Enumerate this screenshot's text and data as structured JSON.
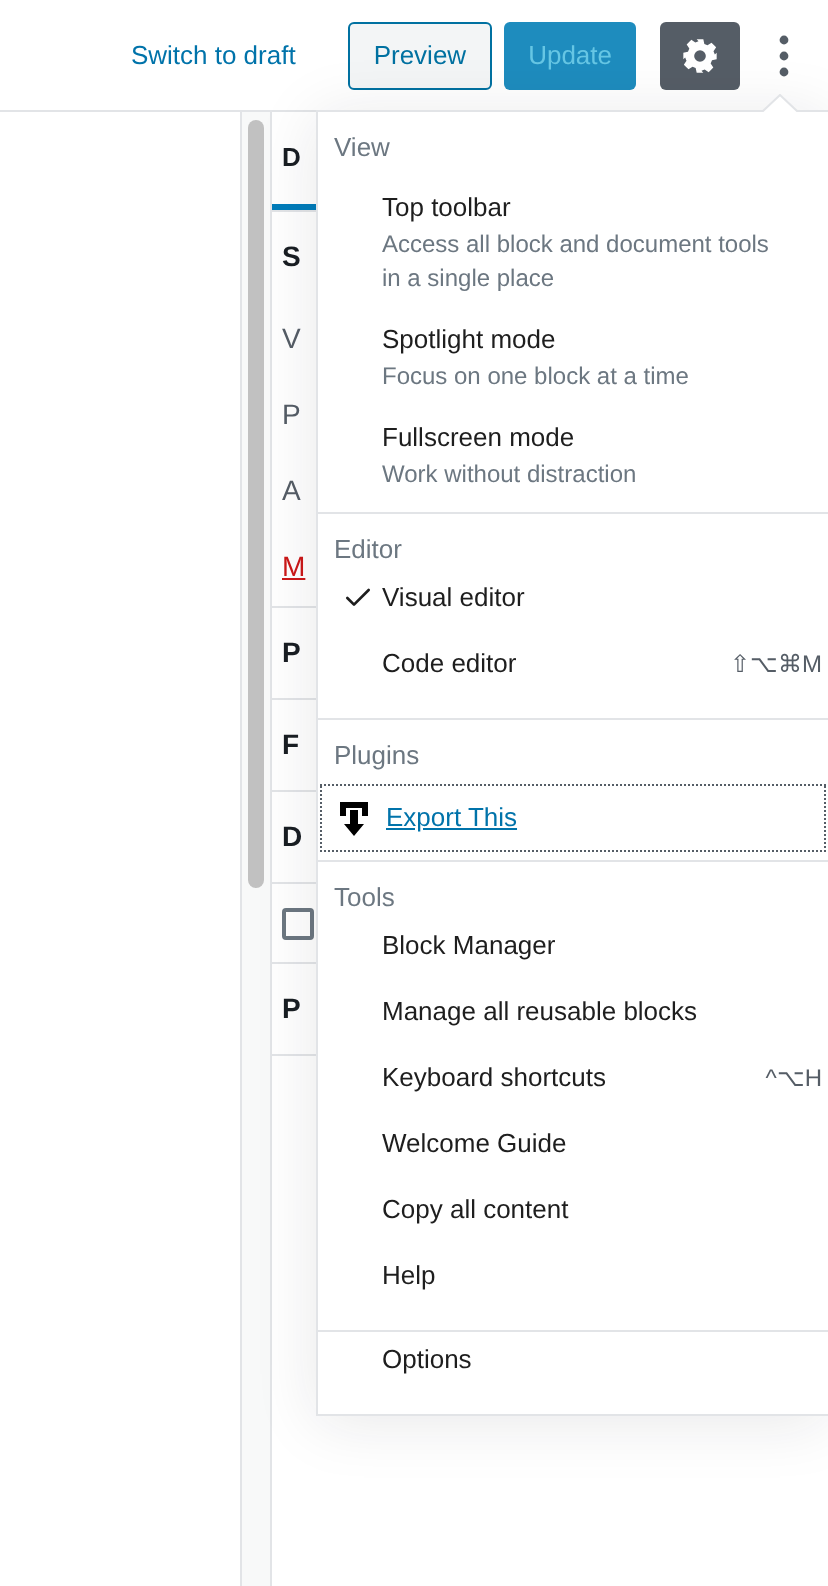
{
  "header": {
    "switch_to_draft": "Switch to draft",
    "preview": "Preview",
    "update": {
      "label": "Update",
      "disabled": true
    },
    "settings": {
      "selected": true
    },
    "more": {
      "expanded": true
    }
  },
  "sidebar": {
    "tabs": [
      {
        "label": "D",
        "selected": true
      }
    ],
    "rows": [
      {
        "kind": "heading",
        "text": "S"
      },
      {
        "kind": "text",
        "text": "V"
      },
      {
        "kind": "text",
        "text": "P"
      },
      {
        "kind": "text",
        "text": "A"
      },
      {
        "kind": "danger",
        "text": "M"
      },
      {
        "kind": "panel",
        "text": "P"
      },
      {
        "kind": "panel",
        "text": "F"
      },
      {
        "kind": "panel",
        "text": "D"
      },
      {
        "kind": "checkbox",
        "checked": false
      },
      {
        "kind": "panel",
        "text": "P"
      }
    ]
  },
  "menu": {
    "groups": [
      {
        "title": "View",
        "items": [
          {
            "label": "Top toolbar",
            "description": "Access all block and document tools in a single place"
          },
          {
            "label": "Spotlight mode",
            "description": "Focus on one block at a time"
          },
          {
            "label": "Fullscreen mode",
            "description": "Work without distraction"
          }
        ]
      },
      {
        "title": "Editor",
        "items": [
          {
            "label": "Visual editor",
            "checked": true
          },
          {
            "label": "Code editor",
            "shortcut": "⇧⌥⌘M",
            "checked": false
          }
        ]
      },
      {
        "title": "Plugins",
        "items": [
          {
            "label": "Export This",
            "kind": "plugin"
          }
        ]
      },
      {
        "title": "Tools",
        "items": [
          {
            "label": "Block Manager"
          },
          {
            "label": "Manage all reusable blocks"
          },
          {
            "label": "Keyboard shortcuts",
            "shortcut": "^⌥H"
          },
          {
            "label": "Welcome Guide"
          },
          {
            "label": "Copy all content"
          },
          {
            "label": "Help"
          }
        ]
      },
      {
        "items": [
          {
            "label": "Options"
          }
        ]
      }
    ]
  }
}
